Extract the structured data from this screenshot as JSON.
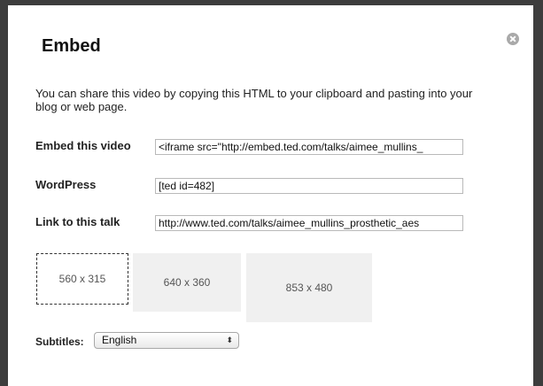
{
  "dialog": {
    "title": "Embed",
    "description": "You can share this video by copying this HTML to your clipboard and pasting into your blog or web page."
  },
  "fields": {
    "embed_label": "Embed this video",
    "embed_value": "<iframe src=\"http://embed.ted.com/talks/aimee_mullins_",
    "wordpress_label": "WordPress",
    "wordpress_value": "[ted id=482]",
    "link_label": "Link to this talk",
    "link_value": "http://www.ted.com/talks/aimee_mullins_prosthetic_aes"
  },
  "sizes": [
    {
      "label": "560 x 315",
      "selected": true
    },
    {
      "label": "640 x 360",
      "selected": false
    },
    {
      "label": "853 x 480",
      "selected": false
    }
  ],
  "subtitles": {
    "label": "Subtitles:",
    "selected": "English",
    "arrows": "⬍"
  },
  "icons": {
    "close": "close-icon"
  }
}
